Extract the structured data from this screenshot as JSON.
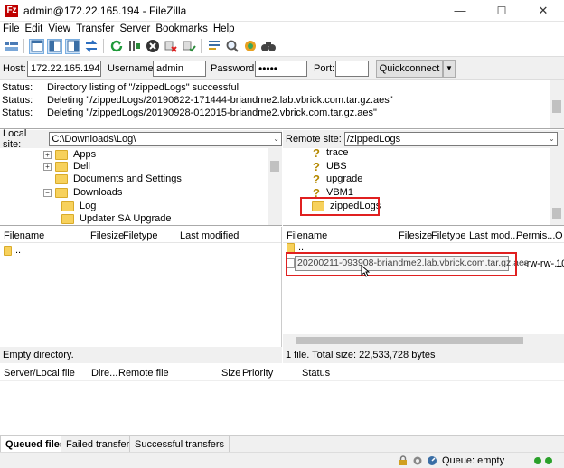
{
  "window": {
    "title": "admin@172.22.165.194 - FileZilla",
    "app_icon": "Fz"
  },
  "window_controls": {
    "minimize": "—",
    "maximize": "☐",
    "close": "✕"
  },
  "menu": [
    "File",
    "Edit",
    "View",
    "Transfer",
    "Server",
    "Bookmarks",
    "Help"
  ],
  "quickconnect": {
    "host_label": "Host:",
    "host_value": "172.22.165.194",
    "username_label": "Username:",
    "username_value": "admin",
    "password_label": "Password:",
    "password_value": "•••••",
    "port_label": "Port:",
    "port_value": "",
    "button": "Quickconnect"
  },
  "log": [
    {
      "k": "Status:",
      "v": "Directory listing of \"/zippedLogs\" successful"
    },
    {
      "k": "Status:",
      "v": "Deleting \"/zippedLogs/20190822-171444-briandme2.lab.vbrick.com.tar.gz.aes\""
    },
    {
      "k": "Status:",
      "v": "Deleting \"/zippedLogs/20190928-012015-briandme2.vbrick.com.tar.gz.aes\""
    }
  ],
  "local": {
    "site_label": "Local site:",
    "path": "C:\\Downloads\\Log\\",
    "tree": [
      "Apps",
      "Dell",
      "Documents and Settings",
      "Downloads",
      "Log",
      "Updater SA Upgrade"
    ],
    "cols": [
      "Filename",
      "Filesize",
      "Filetype",
      "Last modified"
    ],
    "rows": [
      ".."
    ],
    "status": "Empty directory."
  },
  "remote": {
    "site_label": "Remote site:",
    "path": "/zippedLogs",
    "tree": [
      "trace",
      "UBS",
      "upgrade",
      "VBM1",
      "zippedLogs"
    ],
    "cols": [
      "Filename",
      "Filesize",
      "Filetype",
      "Last mod...",
      "Permis...",
      "O"
    ],
    "rows": [
      ".."
    ],
    "file_perm": "-rw-rw-...",
    "file_owner": "10",
    "tooltip": "20200211-093908-briandme2.lab.vbrick.com.tar.gz.aes",
    "status": "1 file. Total size: 22,533,728 bytes"
  },
  "queue": {
    "cols": [
      "Server/Local file",
      "Dire...",
      "Remote file",
      "Size",
      "Priority",
      "Status"
    ]
  },
  "tabs": [
    "Queued files",
    "Failed transfers",
    "Successful transfers"
  ],
  "statusbar": {
    "queue": "Queue: empty"
  },
  "colors": {
    "highlight_box": "#e02020",
    "folder": "#f7d15c"
  }
}
